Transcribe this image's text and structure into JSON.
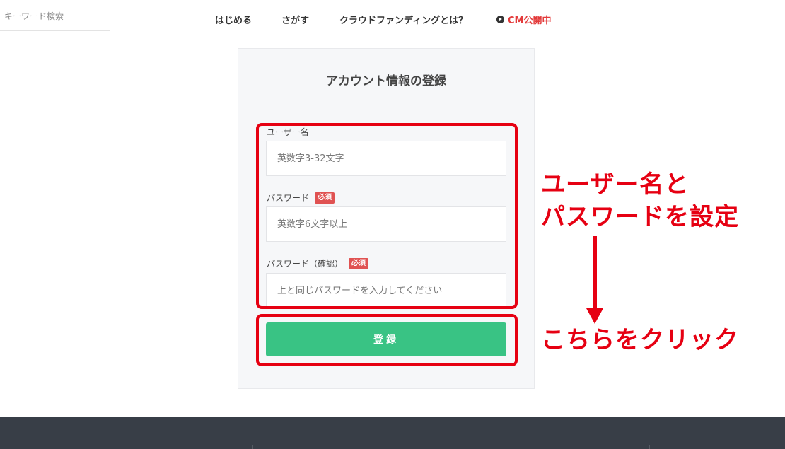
{
  "header": {
    "search_placeholder": "キーワード検索",
    "nav": [
      {
        "label": "はじめる"
      },
      {
        "label": "さがす"
      },
      {
        "label": "クラウドファンディングとは？"
      },
      {
        "label": "CM公開中",
        "icon": "play-circle-icon",
        "color": "#e33b3b"
      }
    ]
  },
  "form": {
    "title": "アカウント情報の登録",
    "fields": [
      {
        "label": "ユーザー名",
        "placeholder": "英数字3-32文字",
        "required": false
      },
      {
        "label": "パスワード",
        "placeholder": "英数字6文字以上",
        "required": true,
        "badge": "必須"
      },
      {
        "label": "パスワード（確認）",
        "placeholder": "上と同じパスワードを入力してください",
        "required": true,
        "badge": "必須"
      }
    ],
    "submit_label": "登録",
    "submit_color": "#39c384"
  },
  "annotations": {
    "line1": "ユーザー名と",
    "line2": "パスワードを設定",
    "line3": "こちらをクリック",
    "color": "#e60012"
  },
  "footer": {
    "background": "#383e47"
  }
}
